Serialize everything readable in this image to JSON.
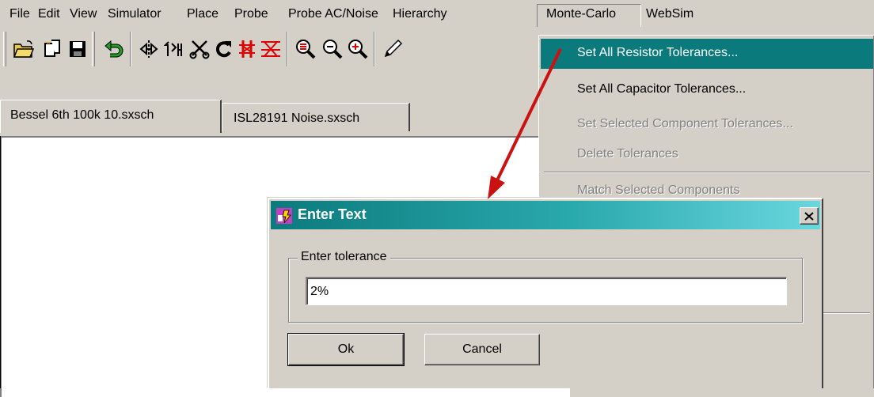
{
  "menubar": {
    "items": [
      {
        "label": "File"
      },
      {
        "label": "Edit"
      },
      {
        "label": "View"
      },
      {
        "label": "Simulator"
      },
      {
        "label": "Place"
      },
      {
        "label": "Probe"
      },
      {
        "label": "Probe AC/Noise"
      },
      {
        "label": "Hierarchy"
      },
      {
        "label": "Monte-Carlo"
      },
      {
        "label": "WebSim"
      }
    ]
  },
  "toolbar": {
    "icons": [
      "open-folder-icon",
      "new-document-icon",
      "save-disk-icon",
      "undo-arrow-icon",
      "mirror-icon",
      "flip-icon",
      "cut-scissors-icon",
      "rotate-icon",
      "stop-red-icon",
      "delete-wire-icon",
      "zoom-fit-icon",
      "zoom-out-icon",
      "zoom-in-icon",
      "pencil-icon"
    ]
  },
  "tabs": [
    {
      "label": "Bessel 6th 100k 10.sxsch",
      "active": true
    },
    {
      "label": "ISL28191 Noise.sxsch",
      "active": false
    }
  ],
  "dropdown": {
    "items": [
      {
        "label": "Set All Resistor Tolerances...",
        "state": "highlighted"
      },
      {
        "label": "Set All Capacitor Tolerances...",
        "state": "enabled"
      },
      {
        "label": "Set Selected Component Tolerances...",
        "state": "disabled"
      },
      {
        "label": "Delete Tolerances",
        "state": "disabled"
      },
      {
        "label": "Match Selected Components",
        "state": "disabled"
      }
    ]
  },
  "dialog": {
    "title": "Enter Text",
    "group_label": "Enter tolerance",
    "input_value": "2%",
    "ok_label": "Ok",
    "cancel_label": "Cancel"
  },
  "colors": {
    "highlight": "#0b7a7d",
    "title_gradient_start": "#0b7a7d",
    "title_gradient_end": "#6ad7de",
    "annotation_arrow": "#cc1111",
    "chrome": "#d4d0c8"
  }
}
